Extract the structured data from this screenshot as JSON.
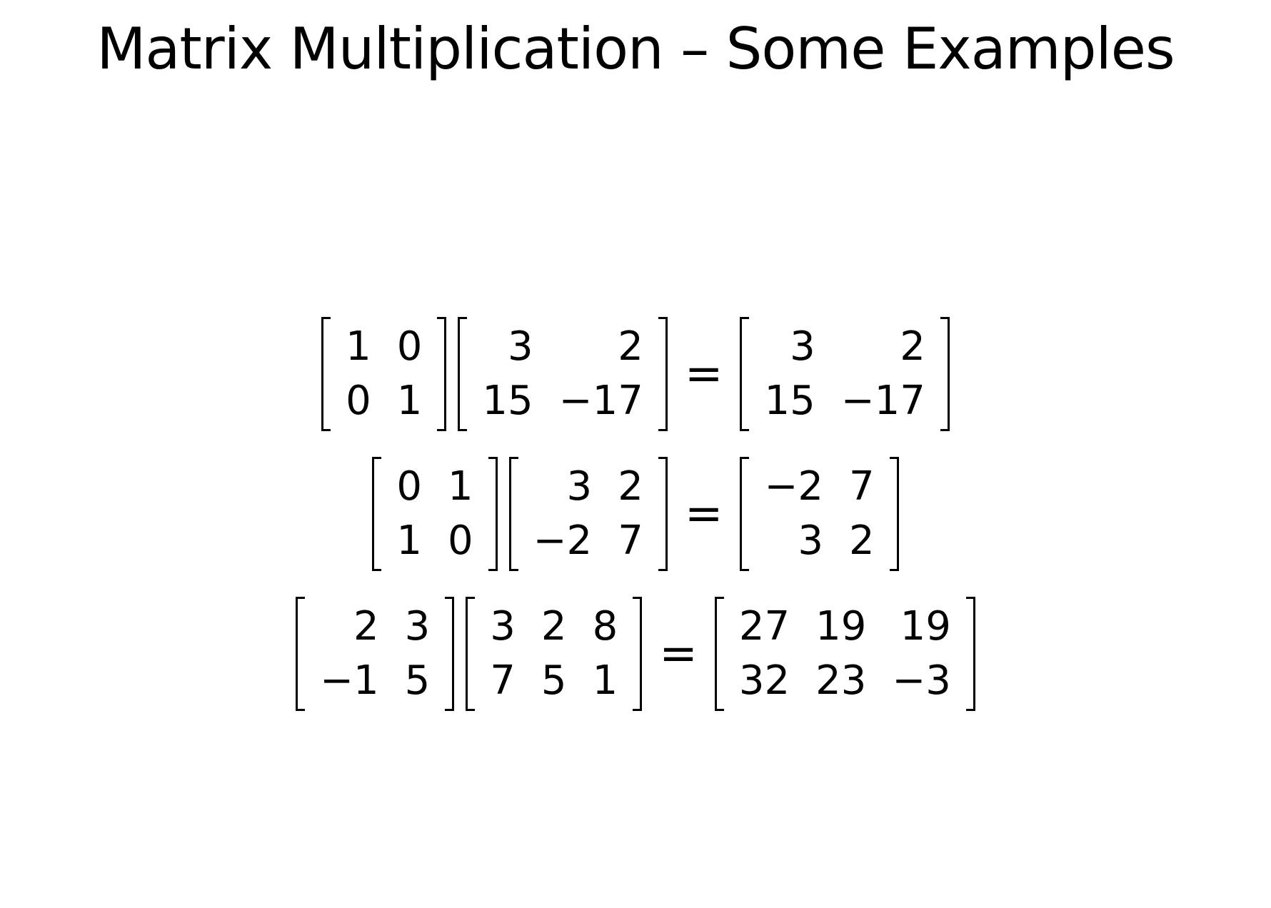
{
  "title": "Matrix Multiplication – Some Examples",
  "equals_sign": "=",
  "equations": [
    {
      "a": [
        [
          "1",
          "0"
        ],
        [
          "0",
          "1"
        ]
      ],
      "b": [
        [
          "3",
          "2"
        ],
        [
          "15",
          "−17"
        ]
      ],
      "result": [
        [
          "3",
          "2"
        ],
        [
          "15",
          "−17"
        ]
      ]
    },
    {
      "a": [
        [
          "0",
          "1"
        ],
        [
          "1",
          "0"
        ]
      ],
      "b": [
        [
          "3",
          "2"
        ],
        [
          "−2",
          "7"
        ]
      ],
      "result": [
        [
          "−2",
          "7"
        ],
        [
          "3",
          "2"
        ]
      ]
    },
    {
      "a": [
        [
          "2",
          "3"
        ],
        [
          "−1",
          "5"
        ]
      ],
      "b": [
        [
          "3",
          "2",
          "8"
        ],
        [
          "7",
          "5",
          "1"
        ]
      ],
      "result": [
        [
          "27",
          "19",
          "19"
        ],
        [
          "32",
          "23",
          "−3"
        ]
      ]
    }
  ]
}
